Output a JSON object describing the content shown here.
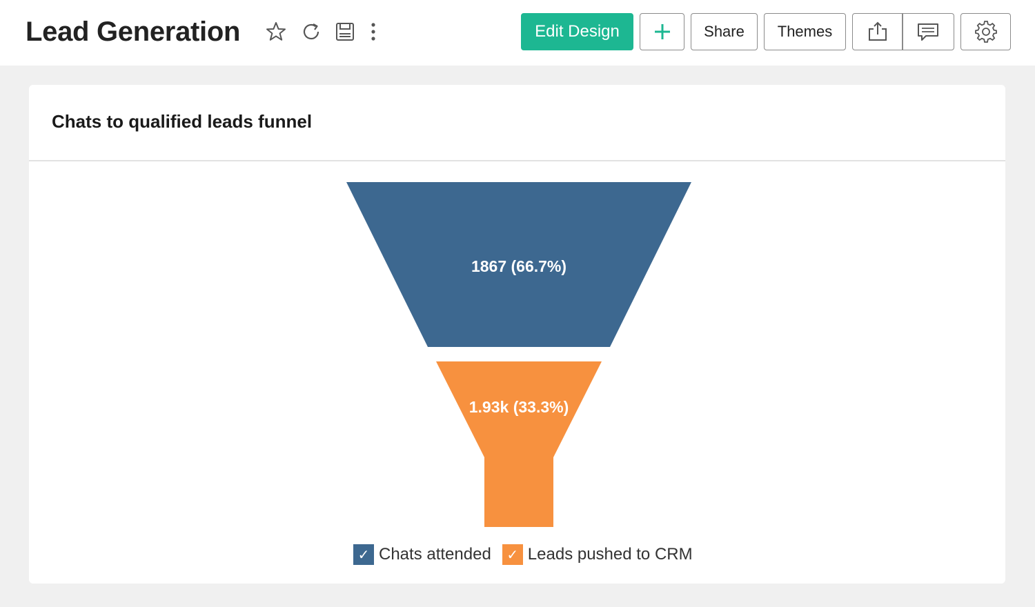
{
  "header": {
    "title": "Lead Generation",
    "edit_design_label": "Edit Design",
    "add_label": "+",
    "share_label": "Share",
    "themes_label": "Themes"
  },
  "icons": {
    "favorite": "star-icon",
    "refresh": "refresh-icon",
    "save": "save-icon",
    "more": "more-vertical-icon",
    "export": "export-icon",
    "comment": "comment-icon",
    "settings": "gear-icon"
  },
  "colors": {
    "accent": "#1db792",
    "series1": "#3d6890",
    "series2": "#f7913f"
  },
  "card": {
    "title": "Chats to qualified leads funnel"
  },
  "chart_data": {
    "type": "funnel",
    "categories": [
      "Chats attended",
      "Leads pushed to CRM"
    ],
    "values": [
      1867,
      1930
    ],
    "labels": [
      "1867 (66.7%)",
      "1.93k (33.3%)"
    ],
    "percentages": [
      66.7,
      33.3
    ],
    "colors": [
      "#3d6890",
      "#f7913f"
    ],
    "legend_position": "bottom",
    "legend_checked": [
      true,
      true
    ]
  },
  "legend": {
    "items": [
      {
        "label": "Chats attended",
        "check": "✓"
      },
      {
        "label": "Leads pushed to CRM",
        "check": "✓"
      }
    ]
  }
}
